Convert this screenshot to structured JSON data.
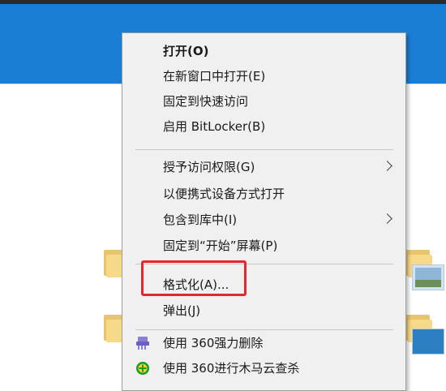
{
  "context_menu": {
    "items": [
      {
        "label": "打开(O)"
      },
      {
        "label": "在新窗口中打开(E)"
      },
      {
        "label": "固定到快速访问"
      },
      {
        "label": "启用 BitLocker(B)"
      },
      {
        "label": "授予访问权限(G)"
      },
      {
        "label": "以便携式设备方式打开"
      },
      {
        "label": "包含到库中(I)"
      },
      {
        "label": "固定到“开始”屏幕(P)"
      },
      {
        "label": "格式化(A)..."
      },
      {
        "label": "弹出(J)"
      },
      {
        "label": "使用 360强力删除",
        "icon": "shredder-icon"
      },
      {
        "label": "使用 360进行木马云查杀",
        "icon": "shield-plus-icon"
      }
    ]
  },
  "colors": {
    "ribbon": "#1a7fd4",
    "menu_bg": "#f0f0f0",
    "highlight": "#e5272c"
  }
}
